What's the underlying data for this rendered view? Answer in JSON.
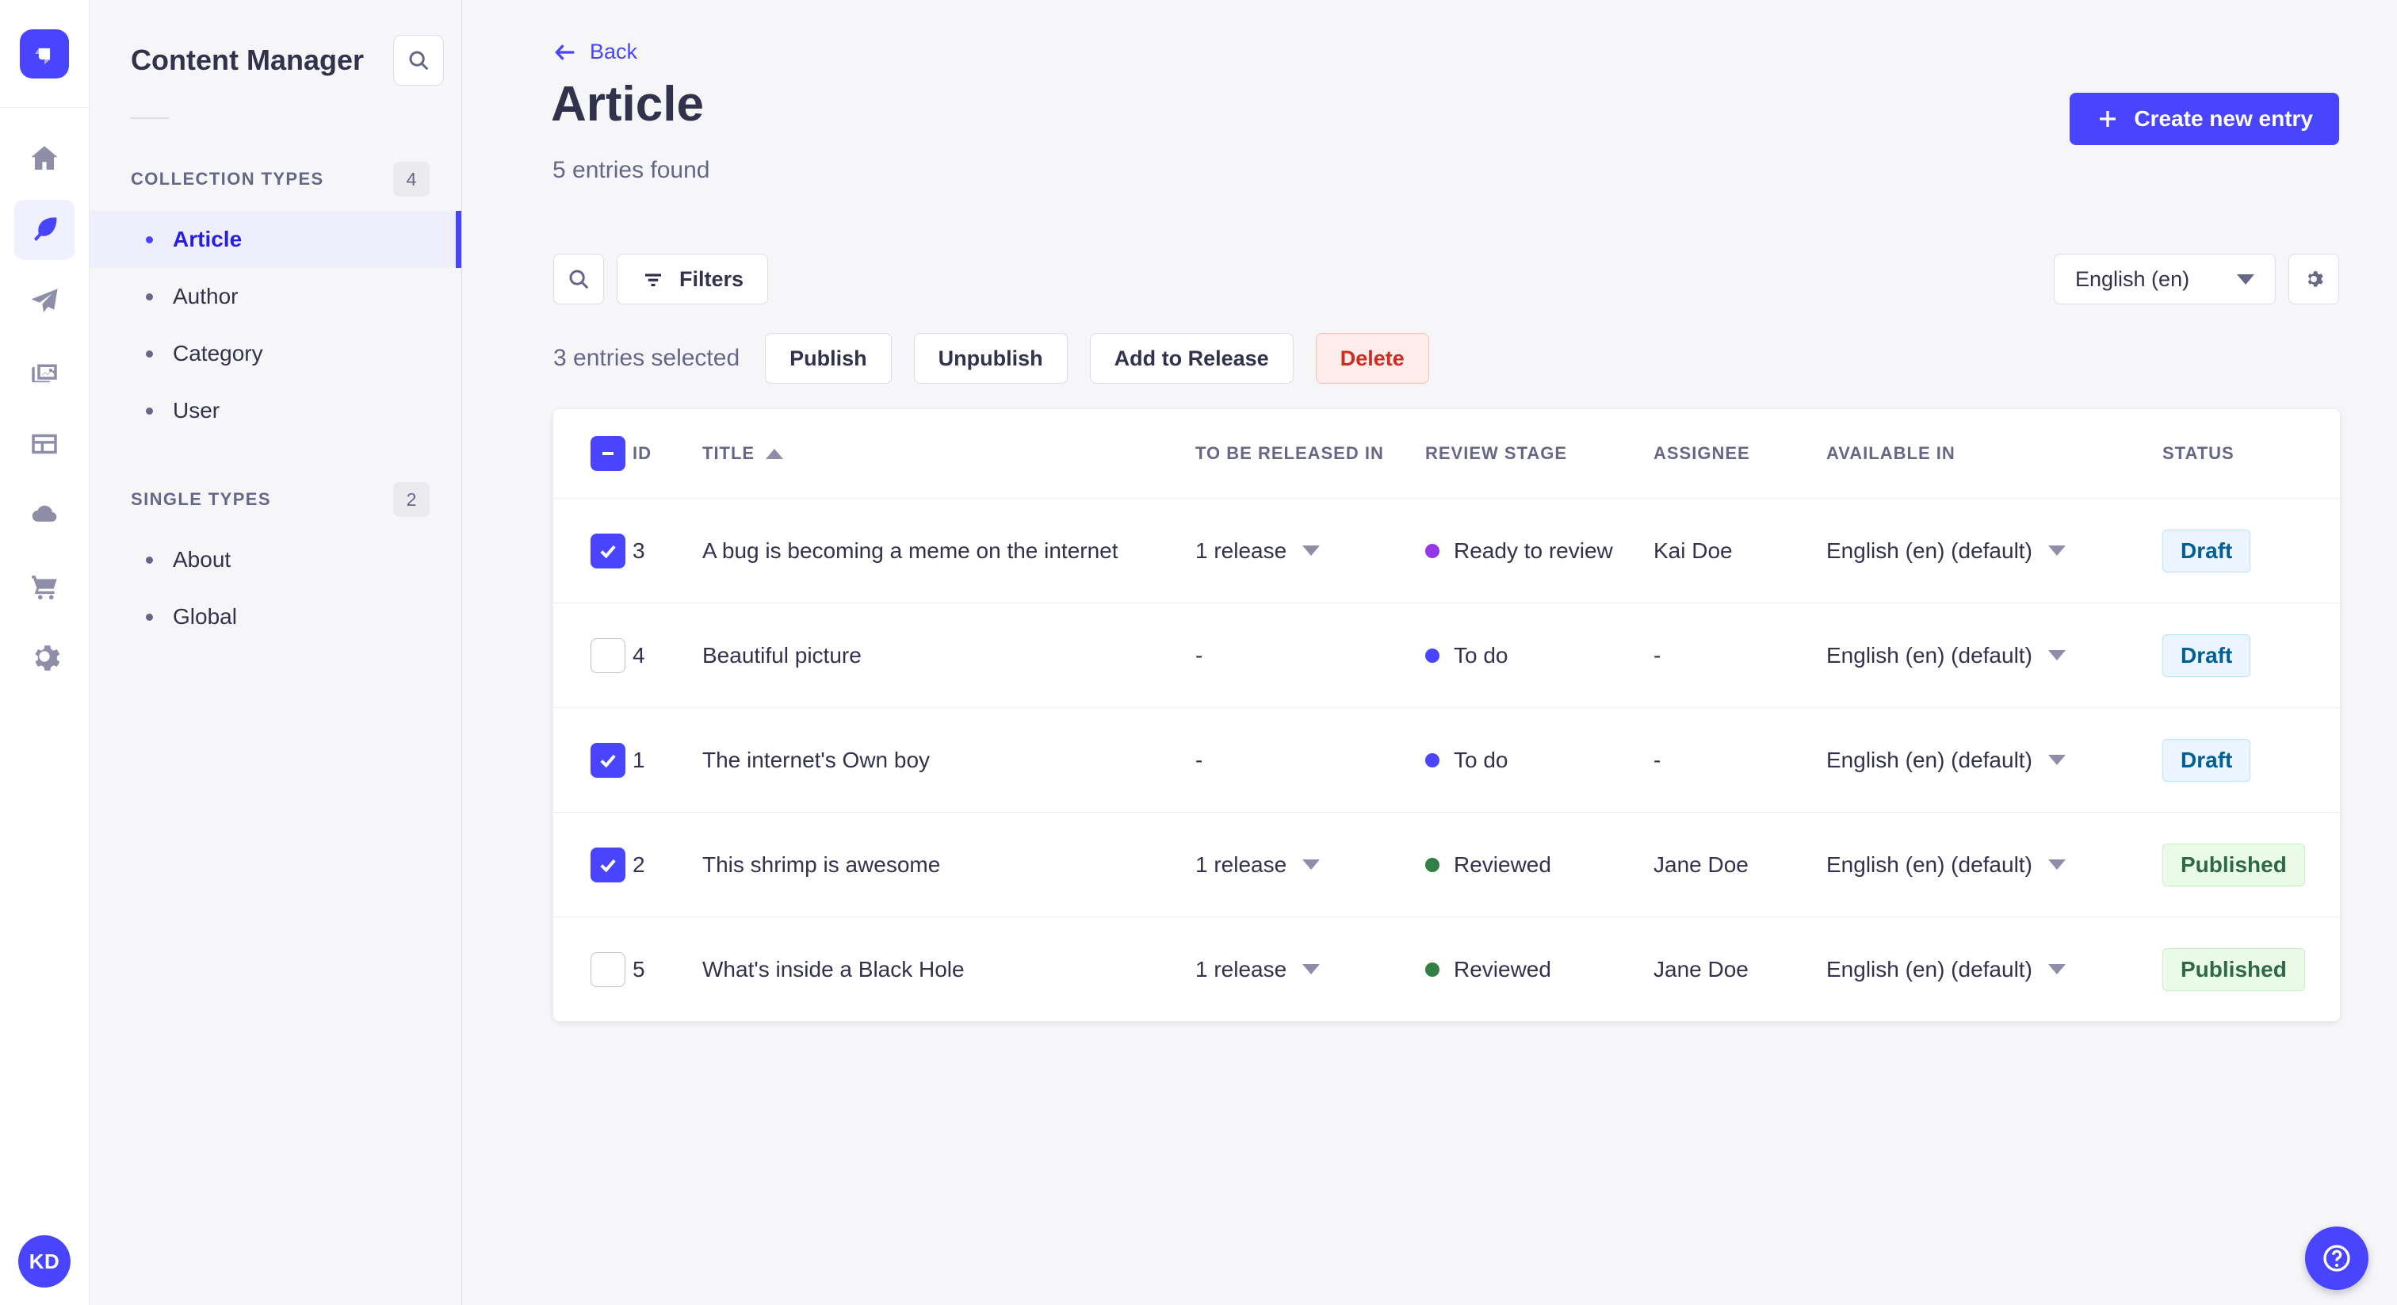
{
  "rail": {
    "logo": "strapi-logo",
    "icons": [
      {
        "name": "home"
      },
      {
        "name": "content",
        "active": true
      },
      {
        "name": "releases"
      },
      {
        "name": "media"
      },
      {
        "name": "content-type-builder"
      },
      {
        "name": "deploy"
      },
      {
        "name": "marketplace"
      },
      {
        "name": "settings"
      }
    ],
    "avatar_initials": "KD"
  },
  "subnav": {
    "title": "Content Manager",
    "sections": [
      {
        "label": "COLLECTION TYPES",
        "count": "4",
        "items": [
          {
            "label": "Article",
            "active": true
          },
          {
            "label": "Author"
          },
          {
            "label": "Category"
          },
          {
            "label": "User"
          }
        ]
      },
      {
        "label": "SINGLE TYPES",
        "count": "2",
        "items": [
          {
            "label": "About"
          },
          {
            "label": "Global"
          }
        ]
      }
    ]
  },
  "header": {
    "back_label": "Back",
    "title": "Article",
    "subtitle": "5 entries found",
    "create_button_label": "Create new entry"
  },
  "toolbar": {
    "filters_label": "Filters",
    "locale_value": "English (en)"
  },
  "selection": {
    "text": "3 entries selected",
    "publish_label": "Publish",
    "unpublish_label": "Unpublish",
    "add_to_release_label": "Add to Release",
    "delete_label": "Delete"
  },
  "table": {
    "select_all_state": "indeterminate",
    "columns": [
      {
        "key": "id",
        "label": "ID"
      },
      {
        "key": "title",
        "label": "TITLE",
        "sorted": true
      },
      {
        "key": "release",
        "label": "TO BE RELEASED IN"
      },
      {
        "key": "stage",
        "label": "REVIEW STAGE"
      },
      {
        "key": "assignee",
        "label": "ASSIGNEE"
      },
      {
        "key": "avail",
        "label": "AVAILABLE IN"
      },
      {
        "key": "status",
        "label": "STATUS"
      }
    ],
    "rows": [
      {
        "checked": true,
        "id": "3",
        "title": "A bug is becoming a meme on the internet",
        "release": "1 release",
        "stage": "Ready to review",
        "stage_color": "#9736e8",
        "assignee": "Kai Doe",
        "avail": "English (en) (default)",
        "status": "Draft"
      },
      {
        "checked": false,
        "id": "4",
        "title": "Beautiful picture",
        "release": "-",
        "stage": "To do",
        "stage_color": "#4945ff",
        "assignee": "-",
        "avail": "English (en) (default)",
        "status": "Draft"
      },
      {
        "checked": true,
        "id": "1",
        "title": "The internet's Own boy",
        "release": "-",
        "stage": "To do",
        "stage_color": "#4945ff",
        "assignee": "-",
        "avail": "English (en) (default)",
        "status": "Draft"
      },
      {
        "checked": true,
        "id": "2",
        "title": "This shrimp is awesome",
        "release": "1 release",
        "stage": "Reviewed",
        "stage_color": "#328048",
        "assignee": "Jane Doe",
        "avail": "English (en) (default)",
        "status": "Published"
      },
      {
        "checked": false,
        "id": "5",
        "title": "What's inside a Black Hole",
        "release": "1 release",
        "stage": "Reviewed",
        "stage_color": "#328048",
        "assignee": "Jane Doe",
        "avail": "English (en) (default)",
        "status": "Published"
      }
    ],
    "status_styles": {
      "Draft": {
        "bg": "#eaf5ff",
        "border": "#b8e1ff",
        "text": "#006096"
      },
      "Published": {
        "bg": "#eafbe7",
        "border": "#c6f0c2",
        "text": "#2f6846"
      }
    }
  },
  "colors": {
    "primary": "#4945ff",
    "primary_text": "#271fe0",
    "text_dark": "#32324d",
    "text_grey": "#666687",
    "danger": "#d02b20"
  }
}
